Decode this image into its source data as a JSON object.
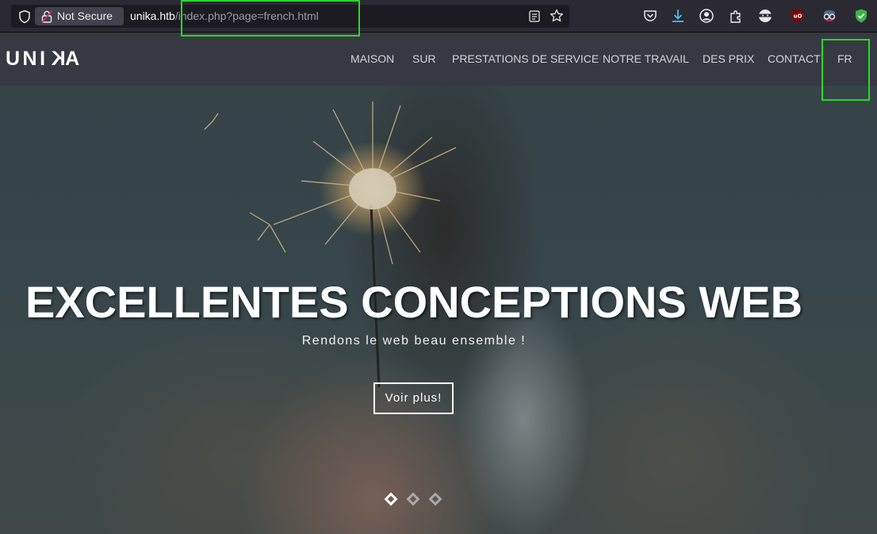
{
  "browser": {
    "security_label": "Not Secure",
    "url_host": "unika.htb",
    "url_path": "/index.php?page=french.html",
    "toolbar_icons": [
      "pocket-icon",
      "download-icon",
      "account-icon",
      "extensions-icon",
      "ninja-extension-icon",
      "ublock-icon",
      "spy-extension-icon",
      "shield-extension-icon"
    ]
  },
  "site": {
    "logo_start": "UNI",
    "logo_reversed": "K",
    "logo_end": "A",
    "nav": [
      "MAISON",
      "SUR",
      "PRESTATIONS DE SERVICE",
      "NOTRE TRAVAIL",
      "DES PRIX",
      "CONTACT",
      "FR"
    ]
  },
  "hero": {
    "title": "EXCELLENTES CONCEPTIONS WEB",
    "subtitle": "Rendons le web beau ensemble !",
    "button_label": "Voir plus!",
    "slide_count": 3,
    "active_slide": 1
  },
  "colors": {
    "highlight": "#22dd22",
    "nav_bg": "#373942",
    "toolbar_bg": "#2b2a33"
  }
}
